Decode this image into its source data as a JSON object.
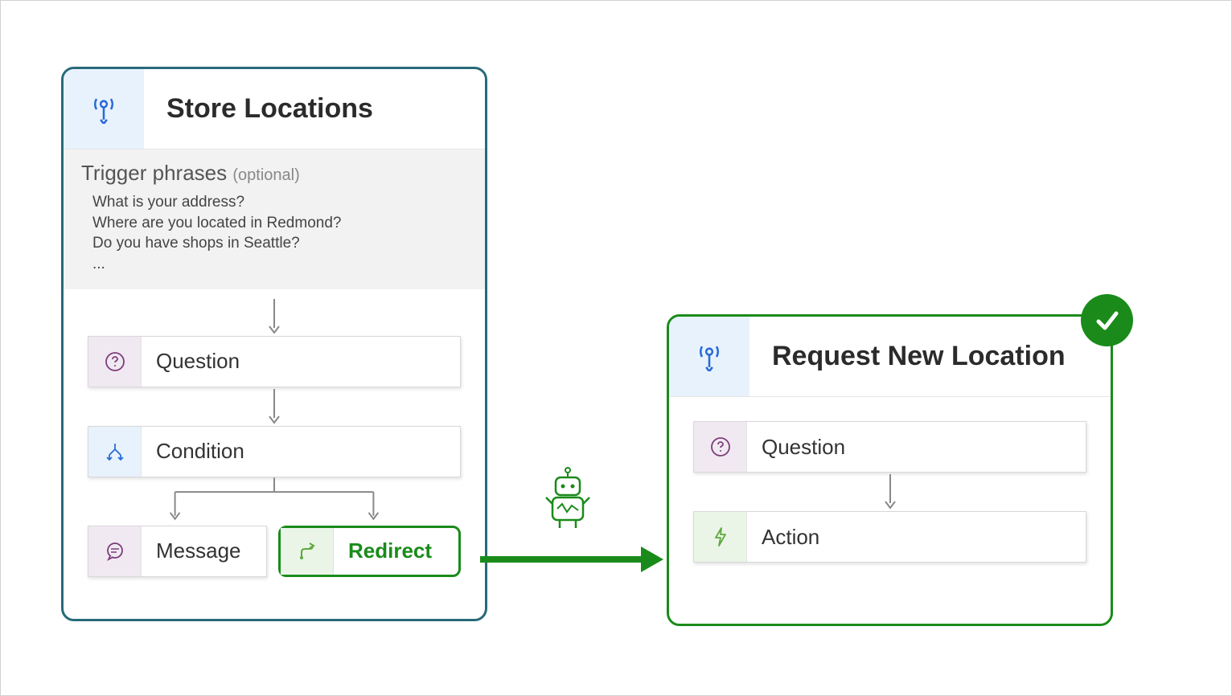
{
  "leftTopic": {
    "title": "Store Locations",
    "triggerHeading": "Trigger phrases",
    "triggerOptional": "(optional)",
    "triggerPhrases": [
      "What is your address?",
      "Where are you located in Redmond?",
      "Do you have shops in Seattle?",
      "..."
    ],
    "nodes": {
      "question": "Question",
      "condition": "Condition",
      "message": "Message",
      "redirect": "Redirect"
    }
  },
  "rightTopic": {
    "title": "Request New Location",
    "nodes": {
      "question": "Question",
      "action": "Action"
    }
  }
}
